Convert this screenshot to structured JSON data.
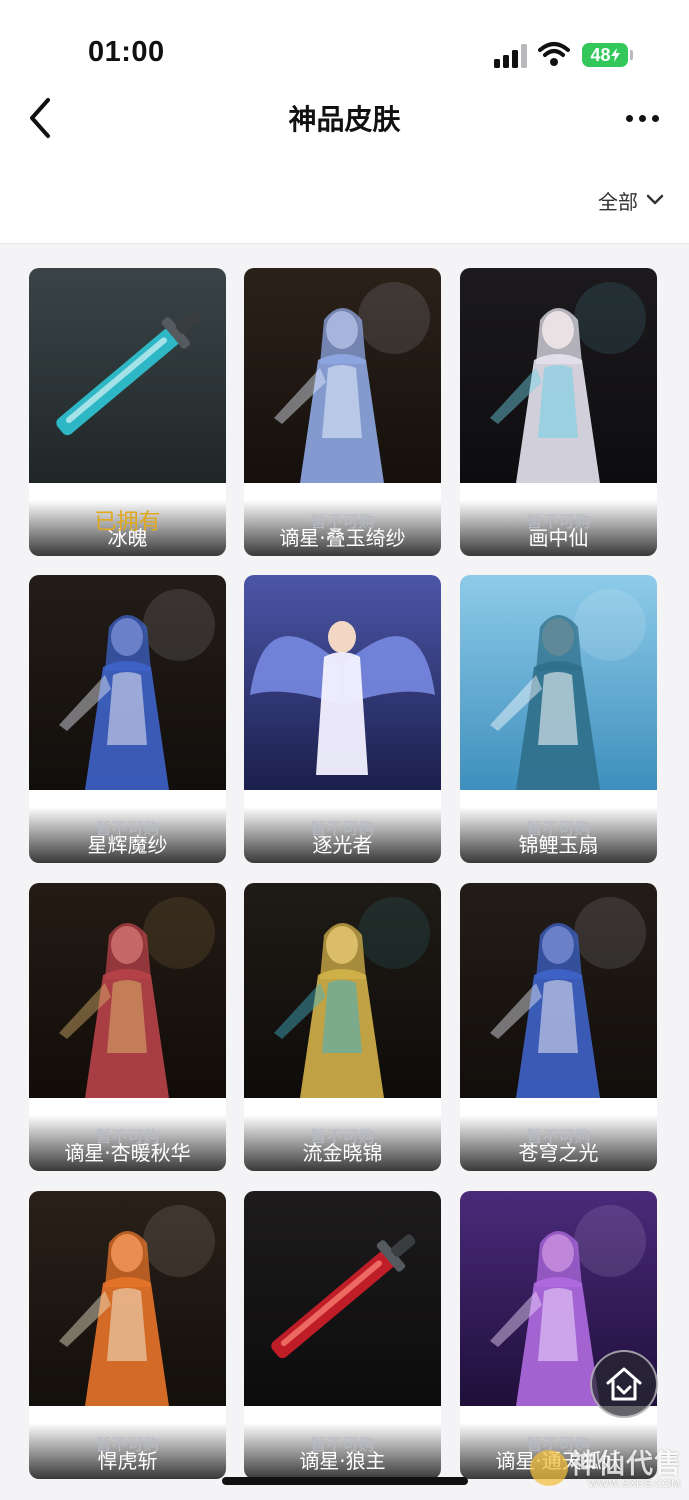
{
  "status_bar": {
    "time": "01:00",
    "battery": "48"
  },
  "header": {
    "title": "神品皮肤",
    "filter_label": "全部"
  },
  "skins": [
    {
      "name": "冰魄",
      "status": "已拥有",
      "owned": true,
      "theme": "sword-ice"
    },
    {
      "name": "谪星·叠玉绮纱",
      "status": "暂不可购",
      "owned": false,
      "theme": "lady-blue"
    },
    {
      "name": "画中仙",
      "status": "暂不可购",
      "owned": false,
      "theme": "fairy-white"
    },
    {
      "name": "星辉魔纱",
      "status": "暂不可购",
      "owned": false,
      "theme": "witch-blue"
    },
    {
      "name": "逐光者",
      "status": "暂不可购",
      "owned": false,
      "theme": "angel-wings"
    },
    {
      "name": "锦鲤玉扇",
      "status": "暂不可购",
      "owned": false,
      "theme": "fan-sky"
    },
    {
      "name": "谪星·杏暖秋华",
      "status": "暂不可购",
      "owned": false,
      "theme": "lady-red"
    },
    {
      "name": "流金晓锦",
      "status": "暂不可购",
      "owned": false,
      "theme": "gold-warrior"
    },
    {
      "name": "苍穹之光",
      "status": "暂不可购",
      "owned": false,
      "theme": "witch-blue"
    },
    {
      "name": "悍虎斩",
      "status": "暂不可购",
      "owned": false,
      "theme": "fire-warrior"
    },
    {
      "name": "谪星·狼主",
      "status": "暂不可购",
      "owned": false,
      "theme": "sword-red"
    },
    {
      "name": "谪星·通天狐妖",
      "status": "暂不可购",
      "owned": false,
      "theme": "fox-purple"
    }
  ],
  "watermark": {
    "text": "神仙代售",
    "url": "WWW.SXDS.COM"
  }
}
